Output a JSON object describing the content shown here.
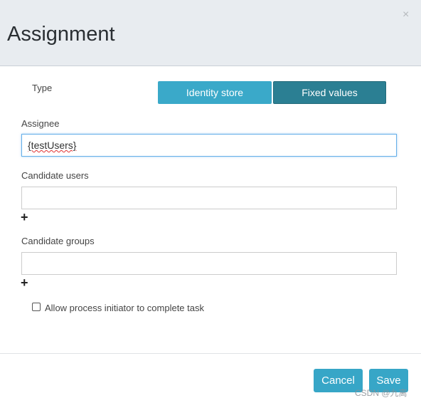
{
  "dialog": {
    "title": "Assignment",
    "close_icon": "×"
  },
  "type": {
    "label": "Type",
    "options": [
      "Identity store",
      "Fixed values"
    ],
    "selected": "Fixed values",
    "colors": {
      "inactive": "#3aa9c9",
      "active": "#2b7f93"
    }
  },
  "assignee": {
    "label": "Assignee",
    "value": "{testUsers}"
  },
  "candidate_users": {
    "label": "Candidate users",
    "value": "",
    "add": "+"
  },
  "candidate_groups": {
    "label": "Candidate groups",
    "value": "",
    "add": "+"
  },
  "allow_initiator": {
    "label": "Allow process initiator to complete task",
    "checked": false
  },
  "footer": {
    "cancel": "Cancel",
    "save": "Save"
  },
  "watermark": "CSDN @九离"
}
